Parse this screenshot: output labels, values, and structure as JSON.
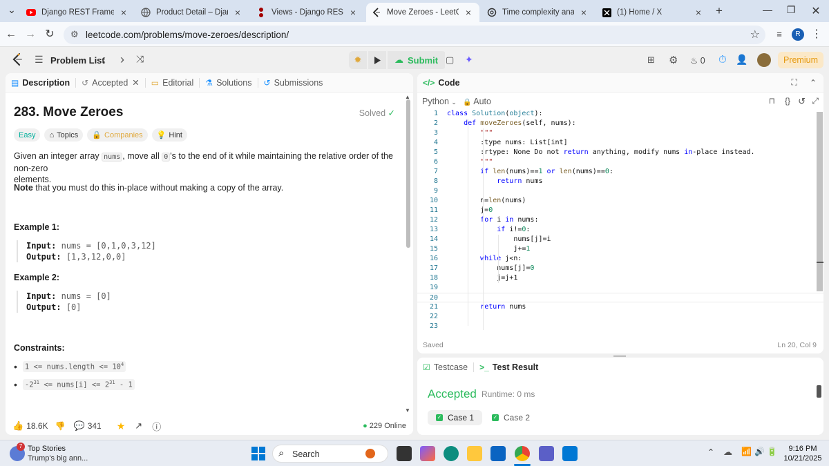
{
  "browser": {
    "tabs": [
      {
        "label": "Django REST Framework se",
        "icon": "youtube-icon",
        "color": "#ff0000"
      },
      {
        "label": "Product Detail – Django RE",
        "icon": "globe-icon",
        "color": "#555555"
      },
      {
        "label": "Views - Django REST frame",
        "icon": "drf-icon",
        "color": "#a30000"
      },
      {
        "label": "Move Zeroes - LeetCode",
        "icon": "leetcode-icon",
        "color": "#000000"
      },
      {
        "label": "Time complexity analysis",
        "icon": "chatgpt-icon",
        "color": "#333333"
      },
      {
        "label": "(1) Home / X",
        "icon": "x-icon",
        "color": "#000000"
      }
    ],
    "url": "leetcode.com/problems/move-zeroes/description/",
    "profile_initial": "R"
  },
  "lcnav": {
    "problem_list": "Problem List",
    "submit": "Submit",
    "streak": "0",
    "premium": "Premium"
  },
  "left": {
    "tabs": {
      "description": "Description",
      "accepted": "Accepted",
      "editorial": "Editorial",
      "solutions": "Solutions",
      "submissions": "Submissions"
    },
    "title": "283. Move Zeroes",
    "solved": "Solved",
    "chips": {
      "easy": "Easy",
      "topics": "Topics",
      "companies": "Companies",
      "hint": "Hint"
    },
    "desc": {
      "p1a": "Given an integer array ",
      "p1code": "nums",
      "p1b": ", move all ",
      "p1code2": "0",
      "p1c": "'s to the end of it while maintaining the relative order of the non-zero",
      "p1d": "elements.",
      "note_b": "Note",
      "note": " that you must do this in-place without making a copy of the array."
    },
    "ex1": {
      "h": "Example 1:",
      "in_l": "Input:",
      "in_v": "nums = [0,1,0,3,12]",
      "out_l": "Output:",
      "out_v": "[1,3,12,0,0]"
    },
    "ex2": {
      "h": "Example 2:",
      "in_l": "Input:",
      "in_v": "nums = [0]",
      "out_l": "Output:",
      "out_v": "[0]"
    },
    "constraints": {
      "h": "Constraints:",
      "c1a": "1 <= nums.length <= 10",
      "c1sup": "4",
      "c2a": "-2",
      "c2sup1": "31",
      "c2b": " <= nums[i] <= 2",
      "c2sup2": "31",
      "c2c": " - 1"
    },
    "footer": {
      "likes": "18.6K",
      "comments": "341",
      "online": "229 Online"
    }
  },
  "code": {
    "tab": "Code",
    "lang": "Python",
    "auto": "Auto",
    "lines": [
      {
        "n": "1",
        "t": ""
      },
      {
        "n": "2",
        "t": ""
      },
      {
        "n": "3",
        "t": ""
      },
      {
        "n": "4",
        "t": ""
      },
      {
        "n": "5",
        "t": ""
      },
      {
        "n": "6",
        "t": ""
      },
      {
        "n": "7",
        "t": ""
      },
      {
        "n": "8",
        "t": ""
      },
      {
        "n": "9",
        "t": ""
      },
      {
        "n": "10",
        "t": ""
      },
      {
        "n": "11",
        "t": ""
      },
      {
        "n": "12",
        "t": ""
      },
      {
        "n": "13",
        "t": ""
      },
      {
        "n": "14",
        "t": ""
      },
      {
        "n": "15",
        "t": ""
      },
      {
        "n": "16",
        "t": ""
      },
      {
        "n": "17",
        "t": ""
      },
      {
        "n": "18",
        "t": ""
      },
      {
        "n": "19",
        "t": ""
      },
      {
        "n": "20",
        "t": ""
      },
      {
        "n": "21",
        "t": ""
      },
      {
        "n": "22",
        "t": ""
      },
      {
        "n": "23",
        "t": ""
      }
    ],
    "code_text": [
      "class Solution(object):",
      "    def moveZeroes(self, nums):",
      "        \"\"\"",
      "        :type nums: List[int]",
      "        :rtype: None Do not return anything, modify nums in-place instead.",
      "        \"\"\"",
      "        if len(nums)==1 or len(nums)==0:",
      "            return nums",
      "",
      "        n=len(nums)",
      "        j=0",
      "        for i in nums:",
      "            if i!=0:",
      "                nums[j]=i",
      "                j+=1",
      "        while j<n:",
      "            nums[j]=0",
      "            j=j+1",
      "",
      "",
      "        return nums",
      "",
      ""
    ],
    "saved": "Saved",
    "cursor": "Ln 20, Col 9"
  },
  "test": {
    "testcase": "Testcase",
    "result": "Test Result",
    "accepted": "Accepted",
    "runtime": "Runtime: 0 ms",
    "case1": "Case 1",
    "case2": "Case 2"
  },
  "taskbar": {
    "news_badge": "7",
    "news_title": "Top Stories",
    "news_sub": "Trump's big ann...",
    "search": "Search",
    "time": "9:16 PM",
    "date": "10/21/2025"
  }
}
